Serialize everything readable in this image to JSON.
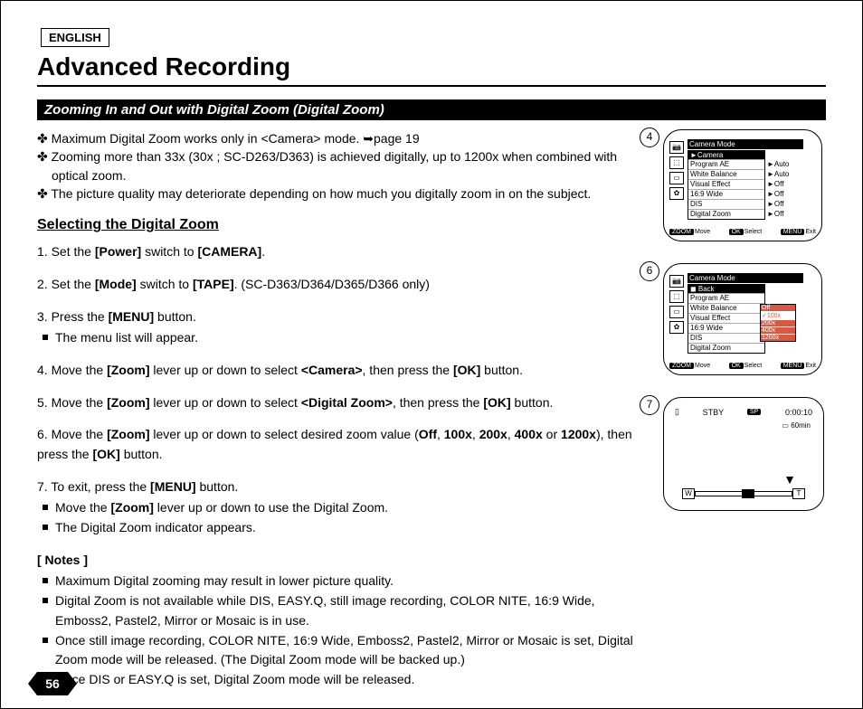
{
  "language": "ENGLISH",
  "title": "Advanced Recording",
  "section": "Zooming In and Out with Digital Zoom (Digital Zoom)",
  "intro": [
    "Maximum Digital Zoom works only in <Camera> mode. ➥page 19",
    "Zooming more than 33x (30x ; SC-D263/D363) is achieved digitally, up to 1200x when combined with optical zoom.",
    "The picture quality may deteriorate depending on how much you digitally zoom in on the subject."
  ],
  "subhead": "Selecting the Digital Zoom",
  "steps": [
    {
      "n": "1.",
      "pre": "Set the",
      "b1": "[Power]",
      "mid": "switch to",
      "b2": "[CAMERA]",
      "post": "."
    },
    {
      "n": "2.",
      "pre": "Set the",
      "b1": "[Mode]",
      "mid": "switch to",
      "b2": "[TAPE]",
      "post": ". (SC-D363/D364/D365/D366 only)"
    },
    {
      "n": "3.",
      "pre": "Press the",
      "b1": "[MENU]",
      "mid": "button.",
      "subs": [
        "The menu list will appear."
      ]
    },
    {
      "n": "4.",
      "pre": "Move the",
      "b1": "[Zoom]",
      "mid": "lever up or down to select",
      "b2": "<Camera>",
      "post": ", then press the ",
      "b3": "[OK]",
      "post2": " button."
    },
    {
      "n": "5.",
      "pre": "Move the",
      "b1": "[Zoom]",
      "mid": "lever up or down to select",
      "b2": "<Digital Zoom>",
      "post": ", then press the ",
      "b3": "[OK]",
      "post2": " button."
    },
    {
      "n": "6.",
      "pre": "Move the",
      "b1": "[Zoom]",
      "mid": "lever up or down to select desired zoom value (",
      "zoomvals": "Off, 100x, 200x, 400x or 1200x",
      "post": "), then press the ",
      "b3": "[OK]",
      "post2": " button."
    },
    {
      "n": "7.",
      "pre": "To exit, press the",
      "b1": "[MENU]",
      "mid": "button.",
      "subs": [
        "Move the [Zoom] lever up or down to use the Digital Zoom.",
        "The Digital Zoom indicator appears."
      ]
    }
  ],
  "notes_head": "[ Notes ]",
  "notes": [
    "Maximum Digital zooming may result in lower picture quality.",
    "Digital Zoom is not available while DIS, EASY.Q, still image recording, COLOR NITE, 16:9 Wide, Emboss2, Pastel2, Mirror or Mosaic is in use.",
    "Once still image recording, COLOR NITE, 16:9 Wide, Emboss2, Pastel2, Mirror or Mosaic is set, Digital Zoom mode will be released. (The Digital Zoom mode will be backed up.)",
    "Once DIS or EASY.Q is set, Digital Zoom mode will be released."
  ],
  "screen4": {
    "num": "4",
    "title": "Camera Mode",
    "menu_hdr": "►Camera",
    "rows": [
      "Program AE",
      "White Balance",
      "Visual Effect",
      "16:9 Wide",
      "DIS",
      "Digital Zoom"
    ],
    "values": [
      "►Auto",
      "►Auto",
      "►Off",
      "►Off",
      "►Off",
      "►Off"
    ],
    "footer": {
      "zoom": "ZOOM",
      "move": "Move",
      "ok": "OK",
      "select": "Select",
      "menu": "MENU",
      "exit": "Exit"
    }
  },
  "screen6": {
    "num": "6",
    "title": "Camera Mode",
    "menu_hdr": "◼ Back",
    "rows": [
      "Program AE",
      "White Balance",
      "Visual Effect",
      "16:9 Wide",
      "DIS",
      "Digital Zoom"
    ],
    "options": {
      "hdr": "Off",
      "rows": [
        "100x",
        "200x",
        "400x",
        "1200x"
      ],
      "sel": 0
    },
    "footer": {
      "zoom": "ZOOM",
      "move": "Move",
      "ok": "OK",
      "select": "Select",
      "menu": "MENU",
      "exit": "Exit"
    }
  },
  "screen7": {
    "num": "7",
    "stby": "STBY",
    "sp": "SP",
    "time": "0:00:10",
    "remain": "60min",
    "w": "W",
    "t": "T"
  },
  "page_number": "56"
}
